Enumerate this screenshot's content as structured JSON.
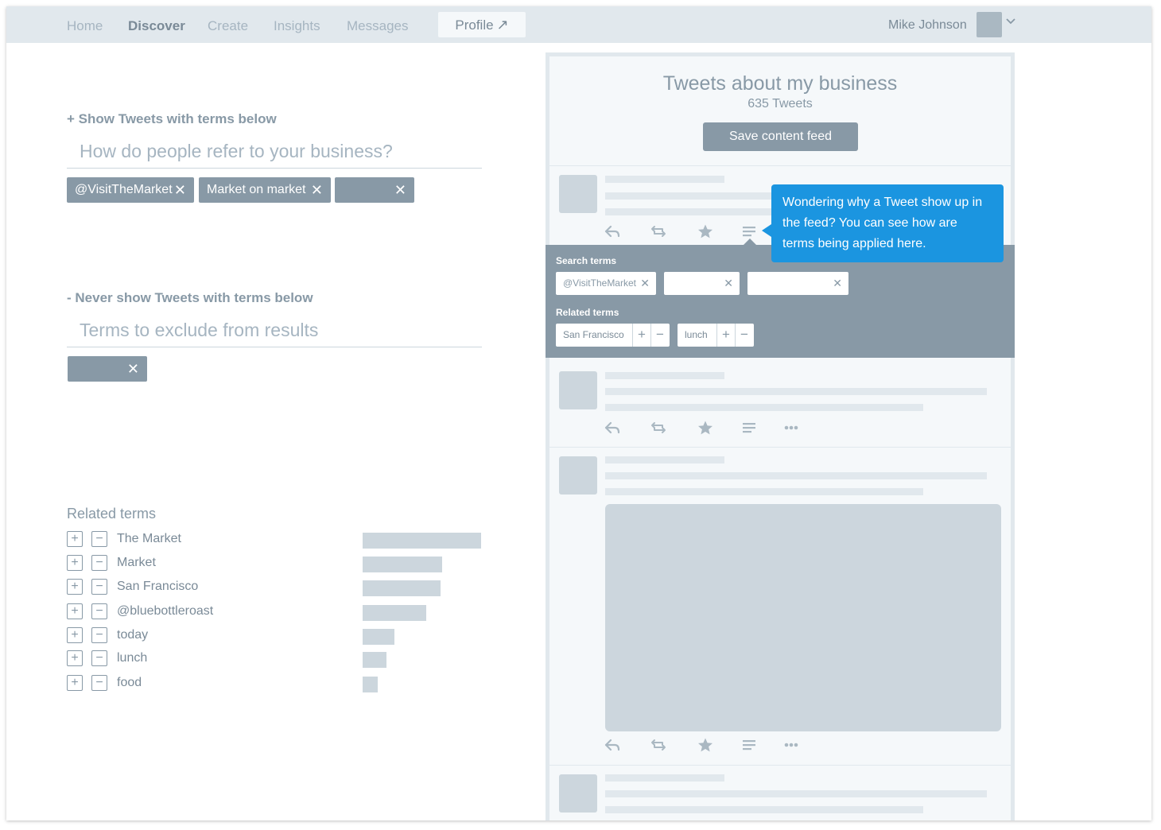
{
  "nav": {
    "items": [
      "Home",
      "Discover",
      "Create",
      "Insights",
      "Messages"
    ],
    "active": "Discover",
    "profile_label": "Profile",
    "profile_arrow": "↗"
  },
  "user": {
    "name": "Mike Johnson"
  },
  "include": {
    "title": "+ Show Tweets with terms below",
    "placeholder": "How do people refer to your business?",
    "tags": [
      "@VisitTheMarket",
      "Market on market",
      ""
    ]
  },
  "exclude": {
    "title": "- Never show Tweets with terms below",
    "placeholder": "Terms to exclude from results",
    "tags": [
      ""
    ]
  },
  "related": {
    "title": "Related terms",
    "items": [
      {
        "label": "The Market",
        "weight": 1.0
      },
      {
        "label": "Market",
        "weight": 0.67
      },
      {
        "label": "San Francisco",
        "weight": 0.66
      },
      {
        "label": "@bluebottleroast",
        "weight": 0.54
      },
      {
        "label": "today",
        "weight": 0.27
      },
      {
        "label": "lunch",
        "weight": 0.2
      },
      {
        "label": "food",
        "weight": 0.13
      }
    ]
  },
  "feed": {
    "title": "Tweets about my business",
    "count": "635 Tweets",
    "save_label": "Save content feed",
    "expand": {
      "search_label": "Search terms",
      "search_terms": [
        "@VisitTheMarket",
        "",
        ""
      ],
      "related_label": "Related terms",
      "related_terms": [
        "San Francisco",
        "lunch"
      ]
    },
    "tooltip": "Wondering why a Tweet show up in the feed? You can see how are terms being applied here."
  },
  "symbols": {
    "close": "✕",
    "plus": "+",
    "minus": "−"
  },
  "colors": {
    "accent": "#1b95e0",
    "tag": "#8899a6",
    "nav_bg": "#e1e8ed",
    "placeholder": "#ccd6dd"
  }
}
